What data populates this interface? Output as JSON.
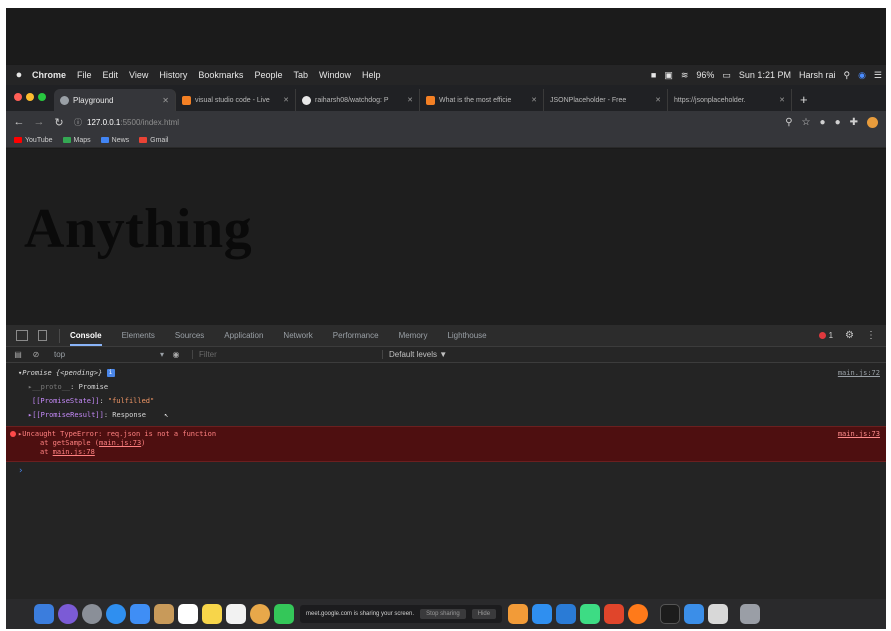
{
  "menubar": {
    "app": "Chrome",
    "items": [
      "File",
      "Edit",
      "View",
      "History",
      "Bookmarks",
      "People",
      "Tab",
      "Window",
      "Help"
    ],
    "battery": "96%",
    "clock": "Sun 1:21 PM",
    "user": "Harsh rai"
  },
  "tabs": [
    {
      "label": "Playground",
      "active": true
    },
    {
      "label": "visual studio code - Live"
    },
    {
      "label": "raiharsh08/watchdog: P"
    },
    {
      "label": "What is the most efficie"
    },
    {
      "label": "JSONPlaceholder - Free"
    },
    {
      "label": "https://jsonplaceholder."
    }
  ],
  "address": {
    "host": "127.0.0.1",
    "path": ":5500/index.html"
  },
  "bookmarks": [
    "YouTube",
    "Maps",
    "News",
    "Gmail"
  ],
  "page": {
    "heading": "Anything"
  },
  "devtools": {
    "tabs": [
      "Console",
      "Elements",
      "Sources",
      "Application",
      "Network",
      "Performance",
      "Memory",
      "Lighthouse"
    ],
    "error_count": "1",
    "context": "top",
    "filter_placeholder": "Filter",
    "levels": "Default levels ▼",
    "console": {
      "promise_header": "▾Promise {<pending>}",
      "proto_key": "▸__proto__",
      "proto_val": ": Promise",
      "state_key": "[[PromiseState]]",
      "state_val": "\"fulfilled\"",
      "result_key": "▸[[PromiseResult]]",
      "result_val": ": Response",
      "log_source": "main.js:72",
      "error_message": "▸Uncaught TypeError: req.json is not a function",
      "error_line1_prefix": "at getSample (",
      "error_line1_link": "main.js:73",
      "error_line1_suffix": ")",
      "error_line2_prefix": "at ",
      "error_line2_link": "main.js:78",
      "error_source": "main.js:73",
      "prompt": "›"
    }
  },
  "dock": {
    "share_text": "meet.google.com is sharing your screen.",
    "stop_label": "Stop sharing",
    "hide_label": "Hide"
  }
}
